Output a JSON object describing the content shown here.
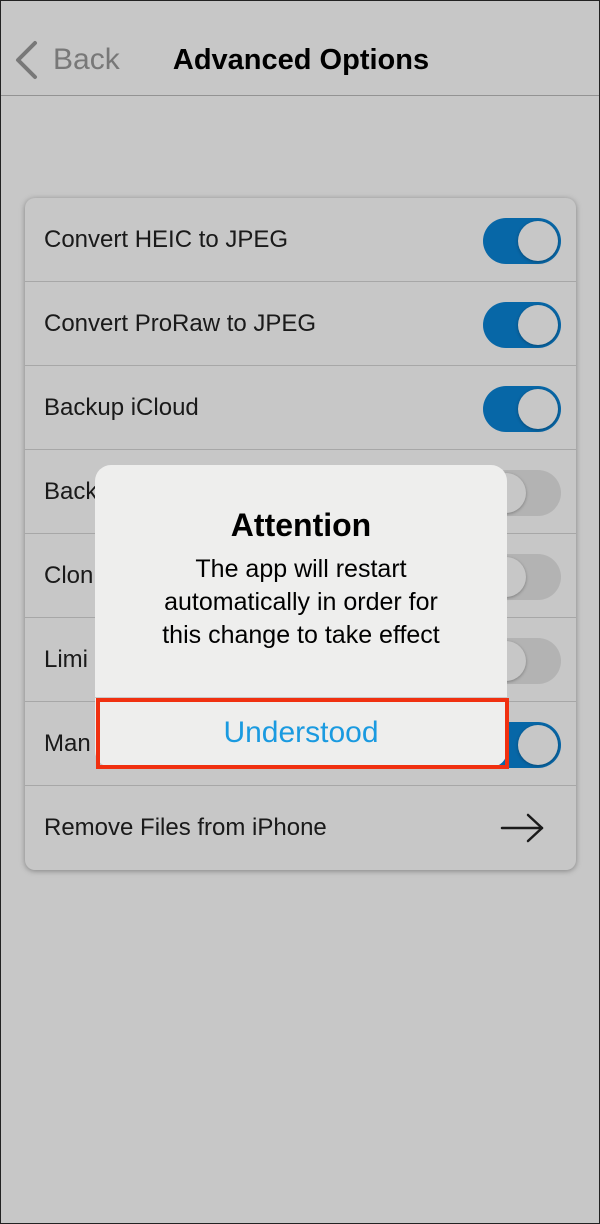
{
  "nav": {
    "back_label": "Back",
    "title": "Advanced Options"
  },
  "settings": {
    "rows": [
      {
        "label": "Convert HEIC to JPEG",
        "control": "toggle",
        "on": true
      },
      {
        "label": "Convert ProRaw to JPEG",
        "control": "toggle",
        "on": true
      },
      {
        "label": "Backup iCloud",
        "control": "toggle",
        "on": true
      },
      {
        "label": "Back",
        "control": "toggle",
        "on": false
      },
      {
        "label": "Clon",
        "control": "toggle",
        "on": false
      },
      {
        "label": "Limi",
        "control": "toggle",
        "on": false
      },
      {
        "label": "Man",
        "control": "toggle",
        "on": true
      },
      {
        "label": "Remove Files from iPhone",
        "control": "arrow"
      }
    ]
  },
  "alert": {
    "title": "Attention",
    "message": "The app will restart\nautomatically in order for\nthis change to take effect",
    "button_label": "Understood"
  },
  "colors": {
    "toggle_on": "#0a84d6",
    "accent_button": "#1a9ae0",
    "highlight": "#f03010"
  }
}
